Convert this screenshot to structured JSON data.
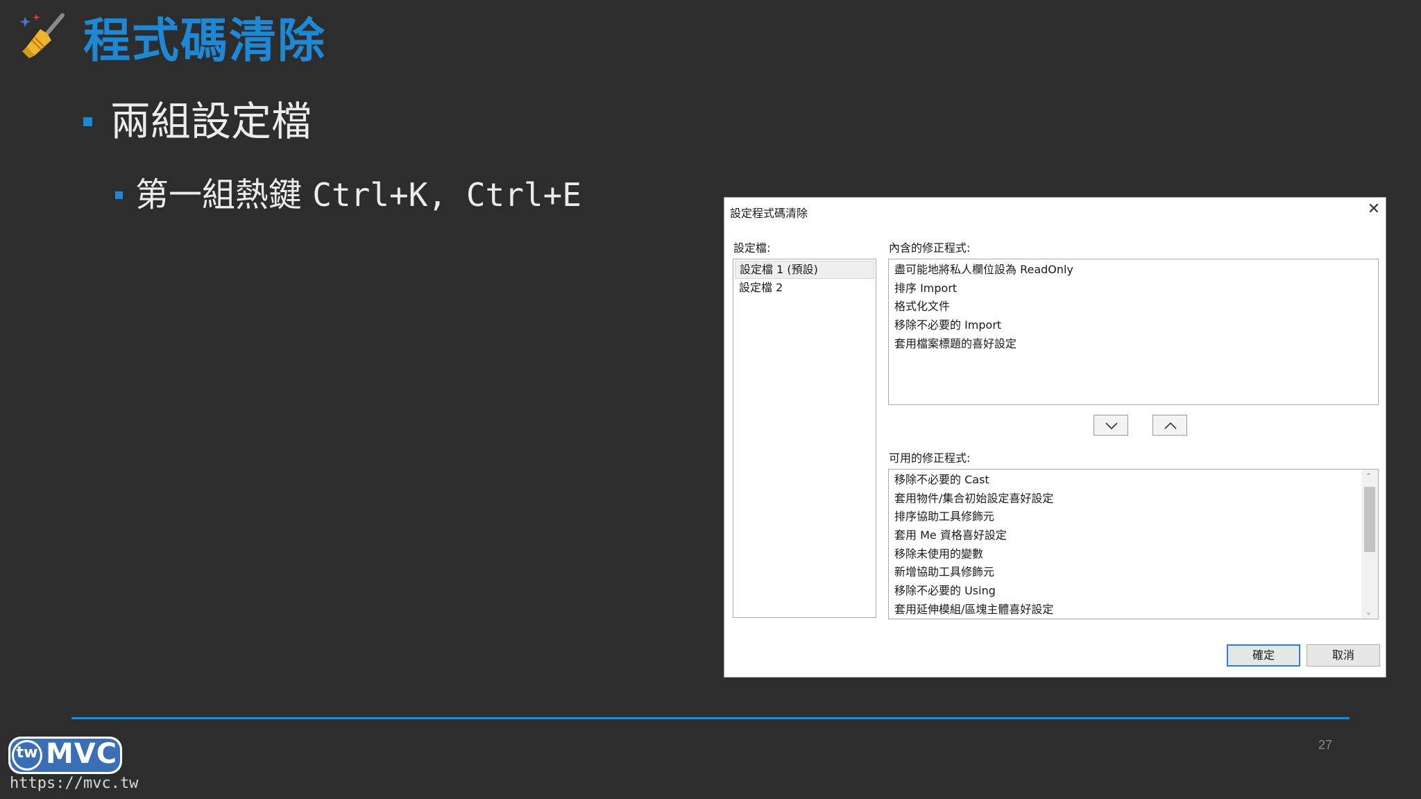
{
  "slide": {
    "title": "程式碼清除",
    "bullet1": "兩組設定檔",
    "bullet2_text": "第一組熱鍵",
    "bullet2_keys": "Ctrl+K, Ctrl+E",
    "page_number": "27",
    "logo_text": "MVC",
    "logo_badge": "tw",
    "url": "https://mvc.tw",
    "accent_color": "#1e88d4"
  },
  "dialog": {
    "title": "設定程式碼清除",
    "profiles_label": "設定檔:",
    "profiles": [
      "設定檔 1 (預設)",
      "設定檔 2"
    ],
    "included_label": "內含的修正程式:",
    "included": [
      "盡可能地將私人欄位設為 ReadOnly",
      "排序 Import",
      "格式化文件",
      "移除不必要的 Import",
      "套用檔案標題的喜好設定"
    ],
    "available_label": "可用的修正程式:",
    "available": [
      "移除不必要的 Cast",
      "套用物件/集合初始設定喜好設定",
      "排序協助工具修飾元",
      "套用 Me 資格喜好設定",
      "移除未使用的變數",
      "新增協助工具修飾元",
      "移除不必要的 Using",
      "套用延伸模組/區塊主體喜好設定"
    ],
    "ok_label": "確定",
    "cancel_label": "取消"
  }
}
